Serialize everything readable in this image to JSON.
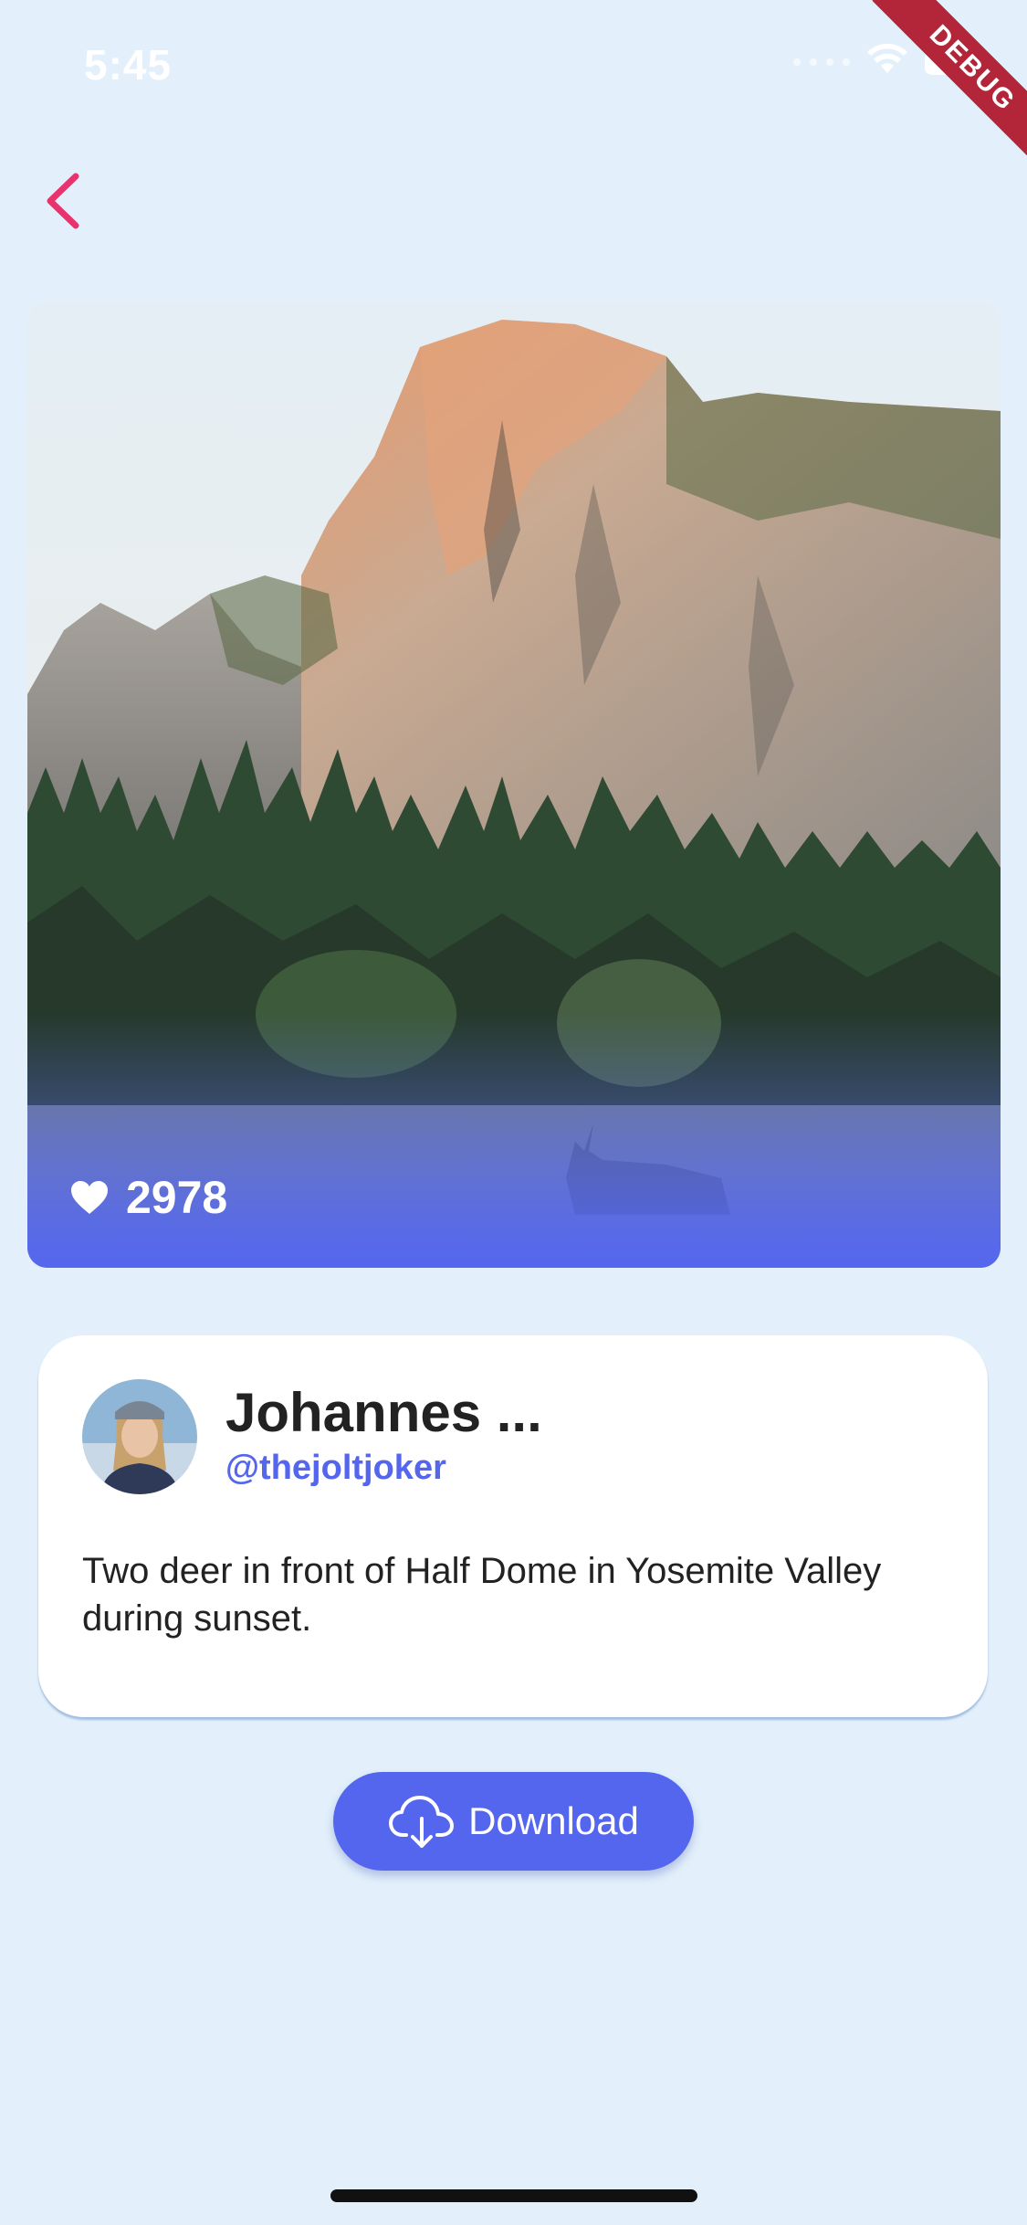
{
  "status_bar": {
    "time": "5:45"
  },
  "debug_banner": {
    "label": "DEBUG"
  },
  "navigation": {
    "back_icon": "chevron-left-icon",
    "accent_color": "#e8336f"
  },
  "photo": {
    "description_icon": "heart-icon",
    "likes": "2978",
    "overlay_color": "#5366f0"
  },
  "author": {
    "name": "Johannes ...",
    "handle": "@thejoltjoker",
    "handle_color": "#5566ee"
  },
  "caption": {
    "text": "Two deer in front of Half Dome in Yosemite Valley during sunset."
  },
  "actions": {
    "download_label": "Download",
    "download_icon": "cloud-download-icon",
    "button_color": "#5466ee"
  },
  "colors": {
    "background": "#e3f0fb"
  }
}
